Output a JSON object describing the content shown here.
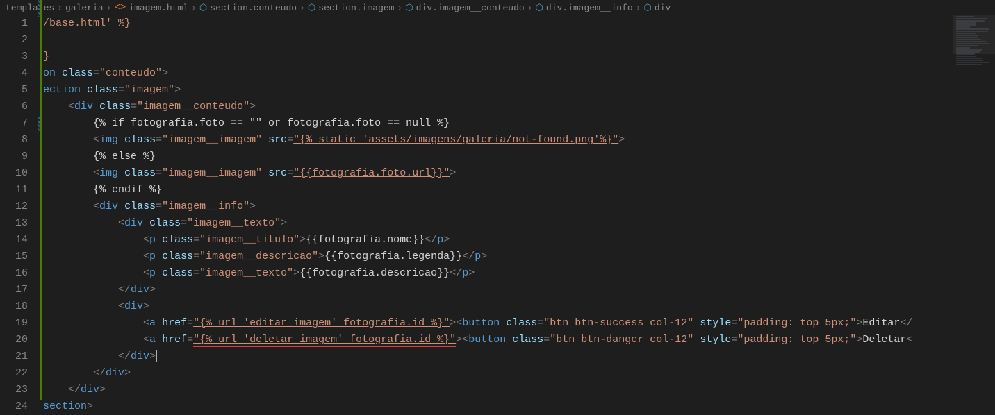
{
  "breadcrumb": [
    {
      "icon": null,
      "label": "templates"
    },
    {
      "icon": null,
      "label": "galeria"
    },
    {
      "icon": "tag",
      "label": "imagem.html"
    },
    {
      "icon": "cube",
      "label": "section.conteudo"
    },
    {
      "icon": "cube",
      "label": "section.imagem"
    },
    {
      "icon": "cube",
      "label": "div.imagem__conteudo"
    },
    {
      "icon": "cube",
      "label": "div.imagem__info"
    },
    {
      "icon": "cube",
      "label": "div"
    }
  ],
  "gutter": [
    "1",
    "2",
    "3",
    "4",
    "5",
    "6",
    "7",
    "8",
    "9",
    "10",
    "11",
    "12",
    "13",
    "14",
    "15",
    "16",
    "17",
    "18",
    "19",
    "20",
    "21",
    "22",
    "23",
    "24"
  ],
  "code": {
    "l1": "/base.html' %}",
    "l3": "}",
    "l4_on": "on ",
    "l4_class": "class",
    "l4_val": "\"conteudo\"",
    "l5_ect": "ection ",
    "l5_class": "class",
    "l5_val": "\"imagem\"",
    "l6_div": "div",
    "l6_class": "class",
    "l6_val": "\"imagem__conteudo\"",
    "l7": "{% if fotografia.foto == \"\" or fotografia.foto == null %}",
    "l8_img": "img",
    "l8_class": "class",
    "l8_cval": "\"imagem__imagem\"",
    "l8_src": "src",
    "l8_sval": "\"{% static 'assets/imagens/galeria/not-found.png'%}\"",
    "l9": "{% else %}",
    "l10_img": "img",
    "l10_class": "class",
    "l10_cval": "\"imagem__imagem\"",
    "l10_src": "src",
    "l10_sval": "\"{{fotografia.foto.url}}\"",
    "l11": "{% endif %}",
    "l12_div": "div",
    "l12_class": "class",
    "l12_val": "\"imagem__info\"",
    "l13_div": "div",
    "l13_class": "class",
    "l13_val": "\"imagem__texto\"",
    "l14_p": "p",
    "l14_class": "class",
    "l14_val": "\"imagem__titulo\"",
    "l14_txt": "{{fotografia.nome}}",
    "l15_p": "p",
    "l15_class": "class",
    "l15_val": "\"imagem__descricao\"",
    "l15_txt": "{{fotografia.legenda}}",
    "l16_p": "p",
    "l16_class": "class",
    "l16_val": "\"imagem__texto\"",
    "l16_txt": "{{fotografia.descricao}}",
    "l17_close": "div",
    "l18_open": "div",
    "l19_a": "a",
    "l19_href": "href",
    "l19_hval": "\"{% url 'editar_imagem' fotografia.id %}\"",
    "l19_btn": "button",
    "l19_bclass": "class",
    "l19_bcval": "\"btn btn-success col-12\"",
    "l19_bstyle": "style",
    "l19_bsval": "\"padding: top 5px;\"",
    "l19_btxt": "Editar",
    "l20_a": "a",
    "l20_href": "href",
    "l20_hval": "\"{% url 'deletar_imagem' fotografia.id %}\"",
    "l20_btn": "button",
    "l20_bclass": "class",
    "l20_bcval": "\"btn btn-danger col-12\"",
    "l20_bstyle": "style",
    "l20_bsval": "\"padding: top 5px;\"",
    "l20_btxt": "Deletar",
    "l21_close": "div",
    "l22_close": "div",
    "l23_close": "div",
    "l24": "section"
  }
}
